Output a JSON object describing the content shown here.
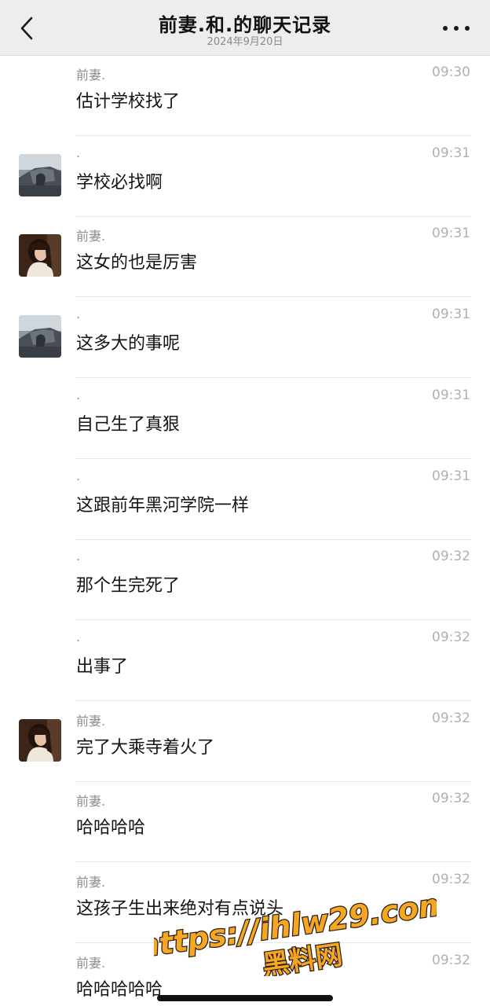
{
  "header": {
    "title": "前妻.和.的聊天记录",
    "date": "2024年9月20日"
  },
  "messages": [
    {
      "sender": "前妻.",
      "time": "09:30",
      "text": "估计学校找了",
      "avatar": "none"
    },
    {
      "sender": ".",
      "time": "09:31",
      "text": "学校必找啊",
      "avatar": "car-photo"
    },
    {
      "sender": "前妻.",
      "time": "09:31",
      "text": "这女的也是厉害",
      "avatar": "woman-photo"
    },
    {
      "sender": ".",
      "time": "09:31",
      "text": "这多大的事呢",
      "avatar": "car-photo"
    },
    {
      "sender": ".",
      "time": "09:31",
      "text": "自己生了真狠",
      "avatar": "none"
    },
    {
      "sender": ".",
      "time": "09:31",
      "text": "这跟前年黑河学院一样",
      "avatar": "none"
    },
    {
      "sender": ".",
      "time": "09:32",
      "text": "那个生完死了",
      "avatar": "none"
    },
    {
      "sender": ".",
      "time": "09:32",
      "text": "出事了",
      "avatar": "none"
    },
    {
      "sender": "前妻.",
      "time": "09:32",
      "text": "完了大乘寺着火了",
      "avatar": "woman-photo"
    },
    {
      "sender": "前妻.",
      "time": "09:32",
      "text": "哈哈哈哈",
      "avatar": "none"
    },
    {
      "sender": "前妻.",
      "time": "09:32",
      "text": "这孩子生出来绝对有点说头",
      "avatar": "none"
    },
    {
      "sender": "前妻.",
      "time": "09:32",
      "text": "哈哈哈哈哈",
      "avatar": "none"
    }
  ],
  "watermark": {
    "url": "https://ihlw29.com",
    "label": "黑料网"
  },
  "colors": {
    "header_bg": "#ededed",
    "watermark_fill": "#f5a623",
    "watermark_stroke": "#2b1b0e"
  }
}
